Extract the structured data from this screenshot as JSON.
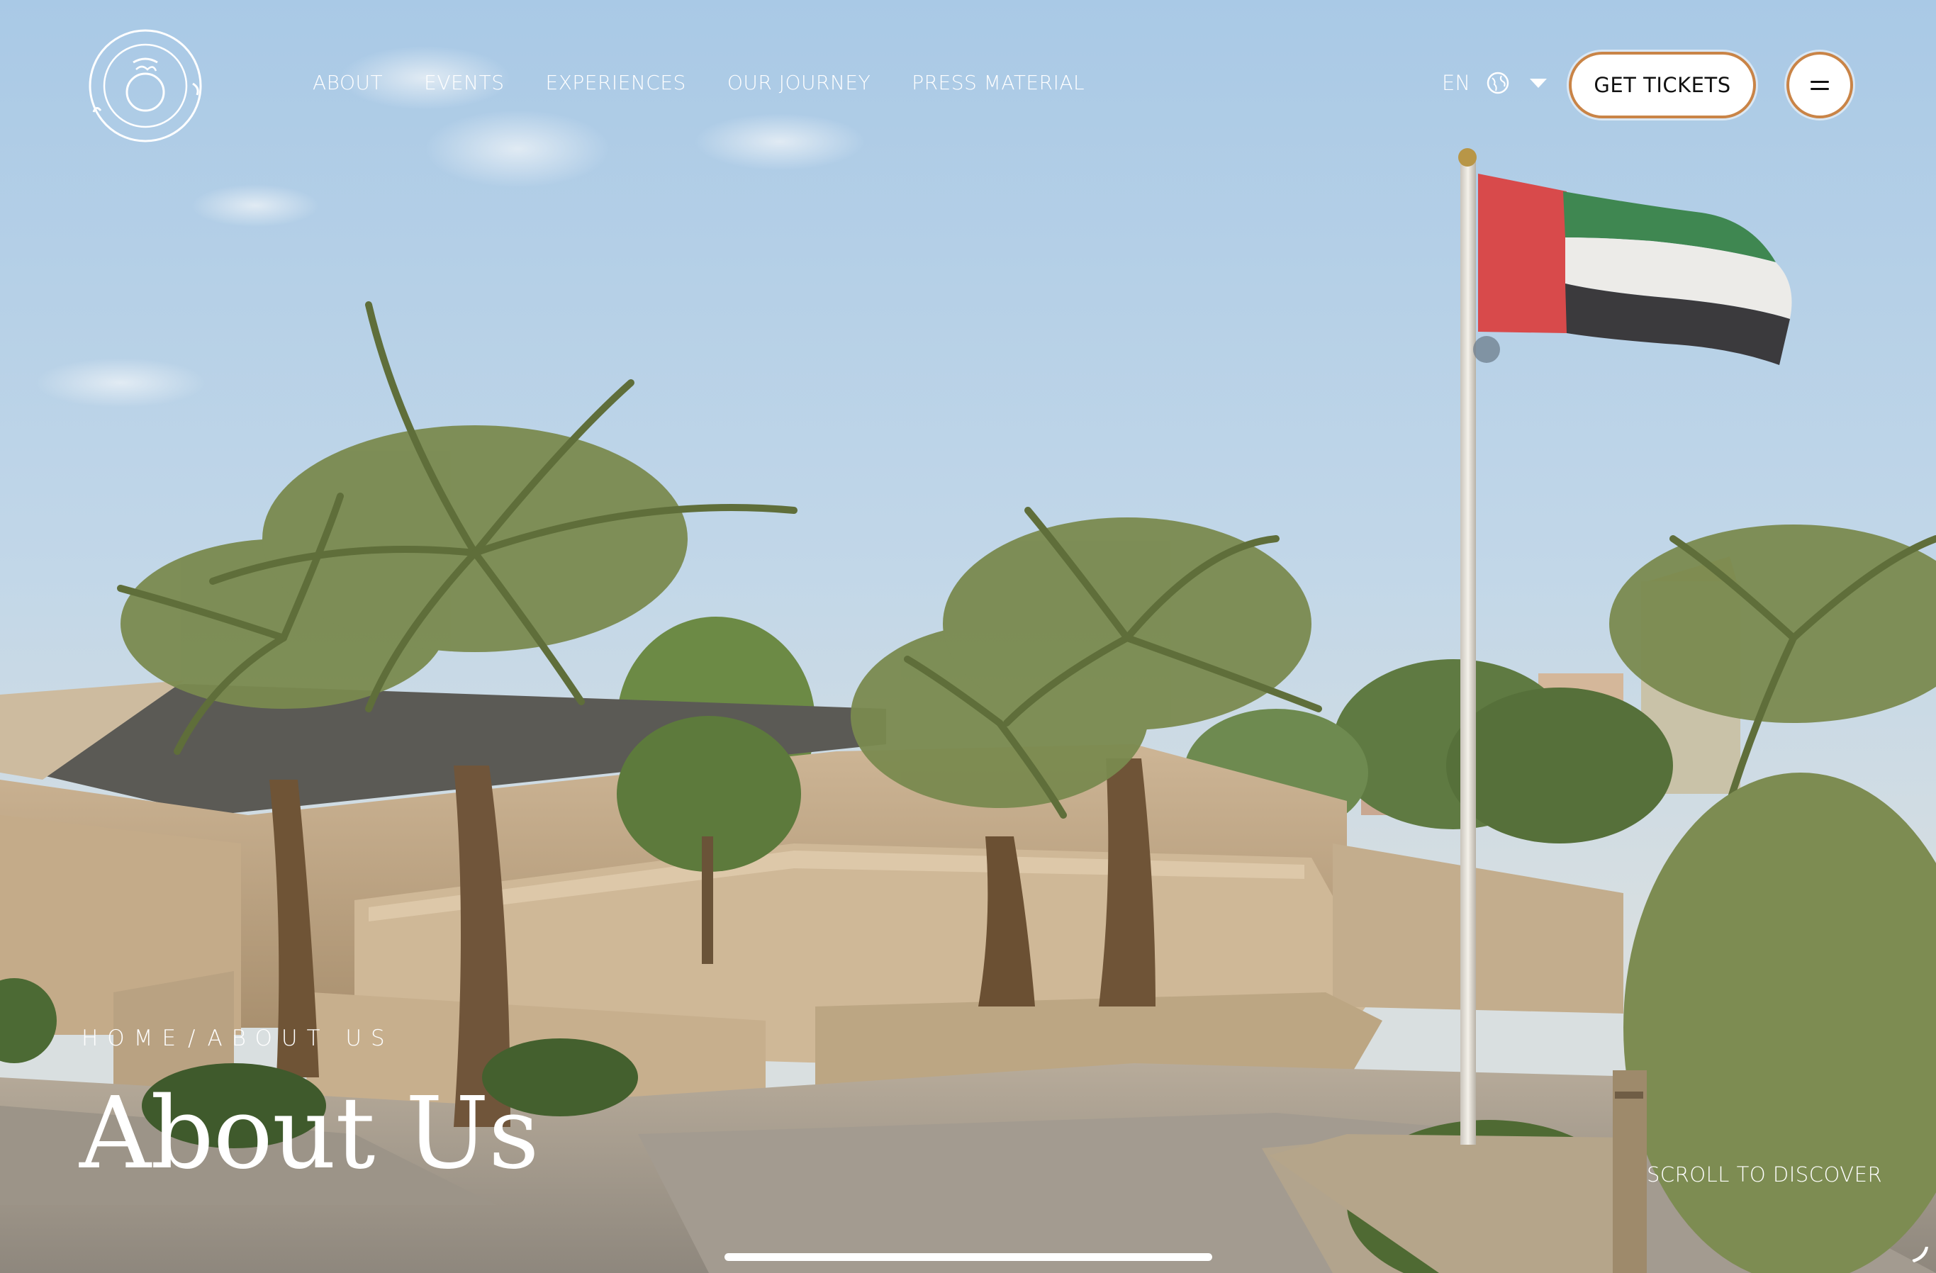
{
  "header": {
    "logo_icon": "circular-arabic-logo",
    "nav": [
      {
        "label": "ABOUT"
      },
      {
        "label": "EVENTS"
      },
      {
        "label": "EXPERIENCES"
      },
      {
        "label": "OUR JOURNEY"
      },
      {
        "label": "PRESS MATERIAL"
      }
    ],
    "language": {
      "code": "EN",
      "icon": "globe-icon",
      "dropdown_icon": "caret-down-icon"
    },
    "tickets_label": "GET TICKETS",
    "menu_icon": "hamburger-icon",
    "accent_color": "#c98447"
  },
  "hero": {
    "breadcrumb": {
      "home": "HOME",
      "separator": "/",
      "current": "ABOUT US"
    },
    "title": "About Us",
    "scroll_label": "SCROLL TO DISCOVER"
  },
  "corner_icon": "phone-icon"
}
